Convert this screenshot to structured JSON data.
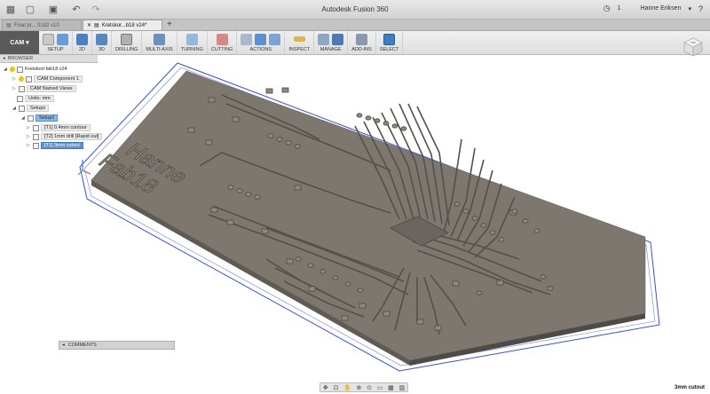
{
  "window": {
    "title": "Autodesk Fusion 360",
    "notifications": "1",
    "user": "Hanne Eriksen"
  },
  "tabs": [
    {
      "label": "Final pr... 0182 v10",
      "active": false
    },
    {
      "label": "Kretskor...b18 v24*",
      "active": true
    }
  ],
  "toolbar": {
    "workspace": "CAM",
    "groups": [
      "SETUP",
      "2D",
      "3D",
      "DRILLING",
      "MULTI-AXIS",
      "TURNING",
      "CUTTING",
      "ACTIONS",
      "INSPECT",
      "MANAGE",
      "ADD-INS",
      "SELECT"
    ]
  },
  "browser": {
    "header": "BROWSER",
    "root": "Kretskort fab18 v24",
    "component": "CAM Component 1",
    "named_views": "CAM Named Views",
    "units": "Units: mm",
    "setups": "Setups",
    "setup1": "Setup1",
    "ops": [
      "[T1] 0.4mm contour",
      "[T2] 1mm drill [Rapid out]",
      "[T1] 3mm cutout"
    ]
  },
  "comments": {
    "label": "COMMENTS"
  },
  "board": {
    "line1": "Hanne",
    "line2": "Fab18"
  },
  "status": {
    "text": "3mm cutout"
  },
  "colors": {
    "board_top": "#7d776f",
    "board_side": "#5f5a54",
    "toolpath": "#3a4fd6",
    "selection": "#5e96d4"
  }
}
